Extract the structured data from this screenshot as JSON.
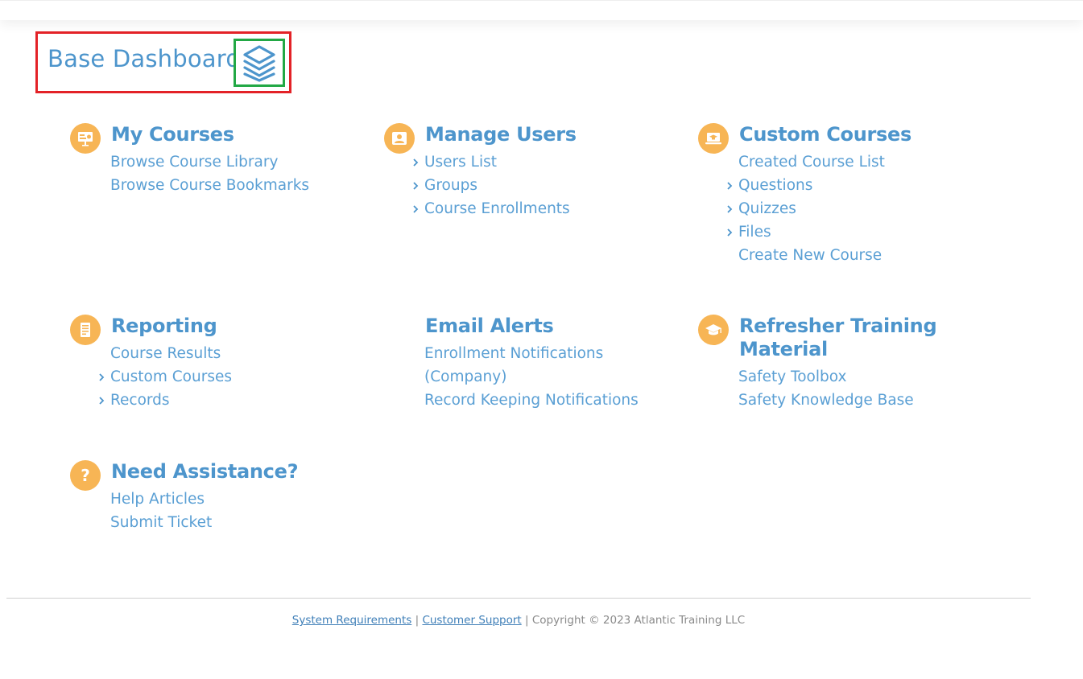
{
  "header": {
    "title": "Base Dashboard",
    "icon": "layers-icon"
  },
  "colors": {
    "primary_text": "#4d95cc",
    "link": "#5a9fd4",
    "icon_badge": "#f7b555",
    "highlight_red": "#e32227",
    "highlight_green": "#22a845"
  },
  "sections": {
    "my_courses": {
      "title": "My Courses",
      "icon": "presentation-icon",
      "links": [
        "Browse Course Library",
        "Browse Course Bookmarks"
      ]
    },
    "manage_users": {
      "title": "Manage Users",
      "icon": "user-card-icon",
      "links": [
        "Users List",
        "Groups",
        "Course Enrollments"
      ]
    },
    "custom_courses": {
      "title": "Custom Courses",
      "icon": "laptop-graduation-icon",
      "links": [
        "Created Course List",
        "Questions",
        "Quizzes",
        "Files",
        "Create New Course"
      ]
    },
    "reporting": {
      "title": "Reporting",
      "icon": "document-icon",
      "links": [
        "Course Results",
        "Custom Courses",
        "Records"
      ]
    },
    "email_alerts": {
      "title": "Email Alerts",
      "links": [
        "Enrollment Notifications",
        "(Company)",
        "Record Keeping Notifications"
      ]
    },
    "refresher": {
      "title_line1": "Refresher Training",
      "title_line2": "Material",
      "icon": "graduation-cap-icon",
      "links": [
        "Safety Toolbox",
        "Safety Knowledge Base"
      ]
    },
    "assistance": {
      "title": "Need Assistance?",
      "icon": "question-icon",
      "links": [
        "Help Articles",
        "Submit Ticket"
      ]
    }
  },
  "footer": {
    "system_requirements": "System Requirements",
    "separator": "|",
    "customer_support": "Customer Support",
    "copyright": "Copyright © 2023 Atlantic Training LLC"
  }
}
